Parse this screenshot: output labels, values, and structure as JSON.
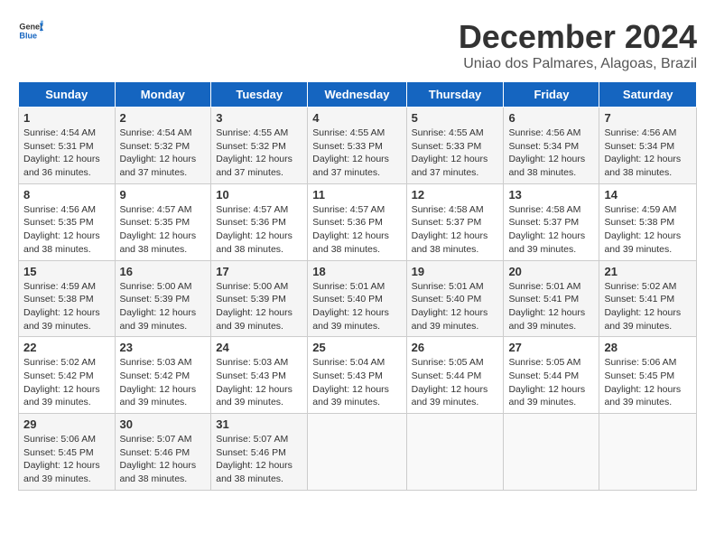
{
  "header": {
    "logo_general": "General",
    "logo_blue": "Blue",
    "month_title": "December 2024",
    "location": "Uniao dos Palmares, Alagoas, Brazil"
  },
  "weekdays": [
    "Sunday",
    "Monday",
    "Tuesday",
    "Wednesday",
    "Thursday",
    "Friday",
    "Saturday"
  ],
  "weeks": [
    [
      {
        "day": "1",
        "sunrise": "Sunrise: 4:54 AM",
        "sunset": "Sunset: 5:31 PM",
        "daylight": "Daylight: 12 hours and 36 minutes."
      },
      {
        "day": "2",
        "sunrise": "Sunrise: 4:54 AM",
        "sunset": "Sunset: 5:32 PM",
        "daylight": "Daylight: 12 hours and 37 minutes."
      },
      {
        "day": "3",
        "sunrise": "Sunrise: 4:55 AM",
        "sunset": "Sunset: 5:32 PM",
        "daylight": "Daylight: 12 hours and 37 minutes."
      },
      {
        "day": "4",
        "sunrise": "Sunrise: 4:55 AM",
        "sunset": "Sunset: 5:33 PM",
        "daylight": "Daylight: 12 hours and 37 minutes."
      },
      {
        "day": "5",
        "sunrise": "Sunrise: 4:55 AM",
        "sunset": "Sunset: 5:33 PM",
        "daylight": "Daylight: 12 hours and 37 minutes."
      },
      {
        "day": "6",
        "sunrise": "Sunrise: 4:56 AM",
        "sunset": "Sunset: 5:34 PM",
        "daylight": "Daylight: 12 hours and 38 minutes."
      },
      {
        "day": "7",
        "sunrise": "Sunrise: 4:56 AM",
        "sunset": "Sunset: 5:34 PM",
        "daylight": "Daylight: 12 hours and 38 minutes."
      }
    ],
    [
      {
        "day": "8",
        "sunrise": "Sunrise: 4:56 AM",
        "sunset": "Sunset: 5:35 PM",
        "daylight": "Daylight: 12 hours and 38 minutes."
      },
      {
        "day": "9",
        "sunrise": "Sunrise: 4:57 AM",
        "sunset": "Sunset: 5:35 PM",
        "daylight": "Daylight: 12 hours and 38 minutes."
      },
      {
        "day": "10",
        "sunrise": "Sunrise: 4:57 AM",
        "sunset": "Sunset: 5:36 PM",
        "daylight": "Daylight: 12 hours and 38 minutes."
      },
      {
        "day": "11",
        "sunrise": "Sunrise: 4:57 AM",
        "sunset": "Sunset: 5:36 PM",
        "daylight": "Daylight: 12 hours and 38 minutes."
      },
      {
        "day": "12",
        "sunrise": "Sunrise: 4:58 AM",
        "sunset": "Sunset: 5:37 PM",
        "daylight": "Daylight: 12 hours and 38 minutes."
      },
      {
        "day": "13",
        "sunrise": "Sunrise: 4:58 AM",
        "sunset": "Sunset: 5:37 PM",
        "daylight": "Daylight: 12 hours and 39 minutes."
      },
      {
        "day": "14",
        "sunrise": "Sunrise: 4:59 AM",
        "sunset": "Sunset: 5:38 PM",
        "daylight": "Daylight: 12 hours and 39 minutes."
      }
    ],
    [
      {
        "day": "15",
        "sunrise": "Sunrise: 4:59 AM",
        "sunset": "Sunset: 5:38 PM",
        "daylight": "Daylight: 12 hours and 39 minutes."
      },
      {
        "day": "16",
        "sunrise": "Sunrise: 5:00 AM",
        "sunset": "Sunset: 5:39 PM",
        "daylight": "Daylight: 12 hours and 39 minutes."
      },
      {
        "day": "17",
        "sunrise": "Sunrise: 5:00 AM",
        "sunset": "Sunset: 5:39 PM",
        "daylight": "Daylight: 12 hours and 39 minutes."
      },
      {
        "day": "18",
        "sunrise": "Sunrise: 5:01 AM",
        "sunset": "Sunset: 5:40 PM",
        "daylight": "Daylight: 12 hours and 39 minutes."
      },
      {
        "day": "19",
        "sunrise": "Sunrise: 5:01 AM",
        "sunset": "Sunset: 5:40 PM",
        "daylight": "Daylight: 12 hours and 39 minutes."
      },
      {
        "day": "20",
        "sunrise": "Sunrise: 5:01 AM",
        "sunset": "Sunset: 5:41 PM",
        "daylight": "Daylight: 12 hours and 39 minutes."
      },
      {
        "day": "21",
        "sunrise": "Sunrise: 5:02 AM",
        "sunset": "Sunset: 5:41 PM",
        "daylight": "Daylight: 12 hours and 39 minutes."
      }
    ],
    [
      {
        "day": "22",
        "sunrise": "Sunrise: 5:02 AM",
        "sunset": "Sunset: 5:42 PM",
        "daylight": "Daylight: 12 hours and 39 minutes."
      },
      {
        "day": "23",
        "sunrise": "Sunrise: 5:03 AM",
        "sunset": "Sunset: 5:42 PM",
        "daylight": "Daylight: 12 hours and 39 minutes."
      },
      {
        "day": "24",
        "sunrise": "Sunrise: 5:03 AM",
        "sunset": "Sunset: 5:43 PM",
        "daylight": "Daylight: 12 hours and 39 minutes."
      },
      {
        "day": "25",
        "sunrise": "Sunrise: 5:04 AM",
        "sunset": "Sunset: 5:43 PM",
        "daylight": "Daylight: 12 hours and 39 minutes."
      },
      {
        "day": "26",
        "sunrise": "Sunrise: 5:05 AM",
        "sunset": "Sunset: 5:44 PM",
        "daylight": "Daylight: 12 hours and 39 minutes."
      },
      {
        "day": "27",
        "sunrise": "Sunrise: 5:05 AM",
        "sunset": "Sunset: 5:44 PM",
        "daylight": "Daylight: 12 hours and 39 minutes."
      },
      {
        "day": "28",
        "sunrise": "Sunrise: 5:06 AM",
        "sunset": "Sunset: 5:45 PM",
        "daylight": "Daylight: 12 hours and 39 minutes."
      }
    ],
    [
      {
        "day": "29",
        "sunrise": "Sunrise: 5:06 AM",
        "sunset": "Sunset: 5:45 PM",
        "daylight": "Daylight: 12 hours and 39 minutes."
      },
      {
        "day": "30",
        "sunrise": "Sunrise: 5:07 AM",
        "sunset": "Sunset: 5:46 PM",
        "daylight": "Daylight: 12 hours and 38 minutes."
      },
      {
        "day": "31",
        "sunrise": "Sunrise: 5:07 AM",
        "sunset": "Sunset: 5:46 PM",
        "daylight": "Daylight: 12 hours and 38 minutes."
      },
      null,
      null,
      null,
      null
    ]
  ]
}
